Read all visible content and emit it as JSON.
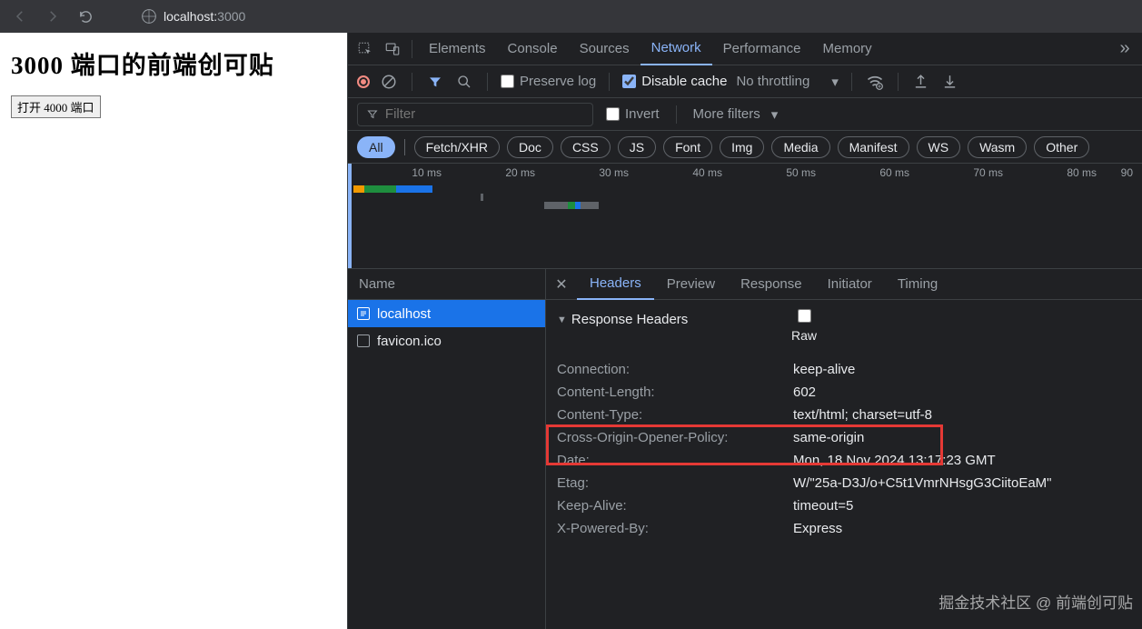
{
  "browser": {
    "url_host": "localhost:",
    "url_port": "3000"
  },
  "page": {
    "heading": "3000 端口的前端创可贴",
    "button_label": "打开 4000 端口"
  },
  "devtools": {
    "tabs": [
      "Elements",
      "Console",
      "Sources",
      "Network",
      "Performance",
      "Memory"
    ],
    "active_tab": "Network",
    "toolbar": {
      "preserve_log": "Preserve log",
      "disable_cache": "Disable cache",
      "throttling": "No throttling"
    },
    "filter": {
      "placeholder": "Filter",
      "invert": "Invert",
      "more": "More filters"
    },
    "type_filters": [
      "All",
      "Fetch/XHR",
      "Doc",
      "CSS",
      "JS",
      "Font",
      "Img",
      "Media",
      "Manifest",
      "WS",
      "Wasm",
      "Other"
    ],
    "timeline_ticks": [
      "10 ms",
      "20 ms",
      "30 ms",
      "40 ms",
      "50 ms",
      "60 ms",
      "70 ms",
      "80 ms",
      "90"
    ],
    "name_panel": {
      "header": "Name",
      "items": [
        {
          "label": "localhost",
          "type": "html",
          "selected": true
        },
        {
          "label": "favicon.ico",
          "type": "ico",
          "selected": false
        }
      ]
    },
    "details": {
      "tabs": [
        "Headers",
        "Preview",
        "Response",
        "Initiator",
        "Timing"
      ],
      "active_tab": "Headers",
      "section_title": "Response Headers",
      "raw_label": "Raw",
      "headers": [
        {
          "key": "Connection:",
          "val": "keep-alive"
        },
        {
          "key": "Content-Length:",
          "val": "602"
        },
        {
          "key": "Content-Type:",
          "val": "text/html; charset=utf-8"
        },
        {
          "key": "Cross-Origin-Opener-Policy:",
          "val": "same-origin"
        },
        {
          "key": "Date:",
          "val": "Mon, 18 Nov 2024 13:17:23 GMT"
        },
        {
          "key": "Etag:",
          "val": "W/\"25a-D3J/o+C5t1VmrNHsgG3CiitoEaM\""
        },
        {
          "key": "Keep-Alive:",
          "val": "timeout=5"
        },
        {
          "key": "X-Powered-By:",
          "val": "Express"
        }
      ]
    }
  },
  "watermark": "掘金技术社区 @ 前端创可贴"
}
